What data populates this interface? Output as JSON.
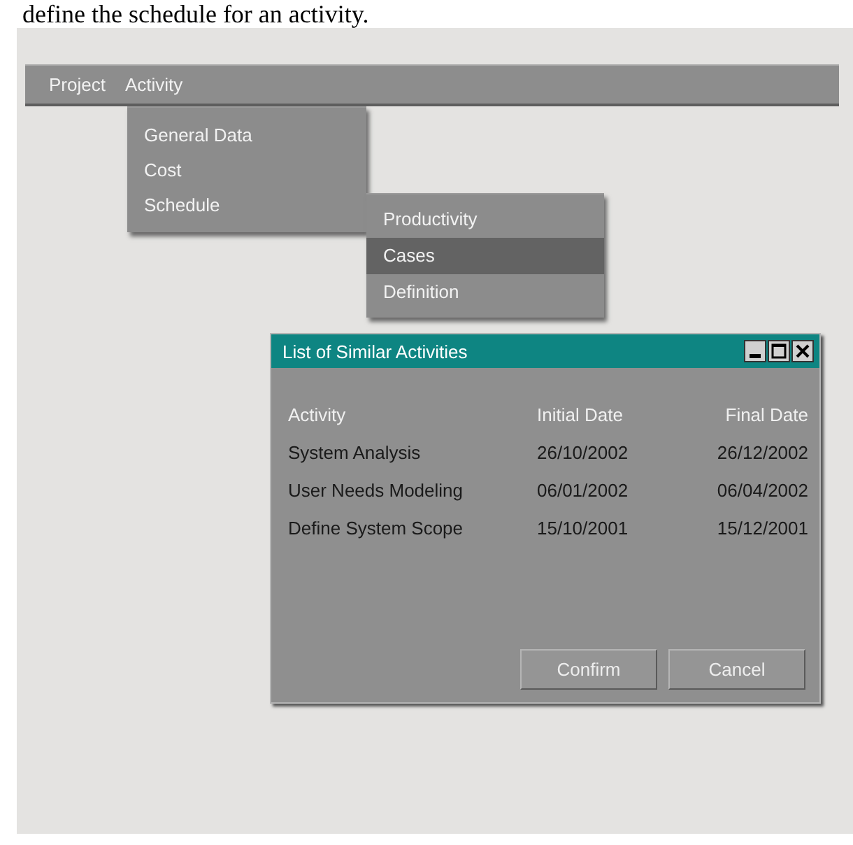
{
  "caption": "define the schedule for an activity.",
  "menubar": [
    {
      "label": "Project"
    },
    {
      "label": "Activity"
    }
  ],
  "activity_menu": [
    {
      "label": "General Data"
    },
    {
      "label": "Cost"
    },
    {
      "label": "Schedule"
    }
  ],
  "schedule_menu": [
    {
      "label": "Productivity",
      "selected": false
    },
    {
      "label": "Cases",
      "selected": true
    },
    {
      "label": "Definition",
      "selected": false
    }
  ],
  "dialog": {
    "title": "List of Similar Activities",
    "columns": [
      "Activity",
      "Initial Date",
      "Final Date"
    ],
    "rows": [
      [
        "System Analysis",
        "26/10/2002",
        "26/12/2002"
      ],
      [
        "User Needs Modeling",
        "06/01/2002",
        "06/04/2002"
      ],
      [
        "Define System Scope",
        "15/10/2001",
        "15/12/2001"
      ]
    ],
    "buttons": [
      "Confirm",
      "Cancel"
    ]
  }
}
